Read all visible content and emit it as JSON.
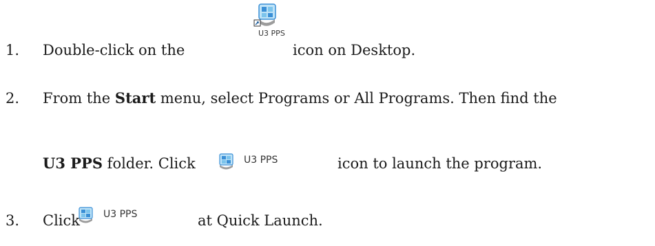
{
  "steps": [
    {
      "number": "1.",
      "text_before": "Double-click on the",
      "icon_label": "U3 PPS",
      "text_after": "icon on Desktop."
    },
    {
      "number": "2.",
      "line1_before": "From the",
      "line1_bold": "Start",
      "line1_after": "menu, select Programs or All Programs. Then find the",
      "line2_bold": "U3 PPS",
      "line2_mid": "folder. Click",
      "icon_label": "U3 PPS",
      "line2_after": "icon to launch the program."
    },
    {
      "number": "3.",
      "text_before": "Click",
      "icon_label": "U3 PPS",
      "text_after": "at Quick Launch."
    }
  ],
  "icons": {
    "desktop_shortcut": "u3-pps-shortcut-icon",
    "program": "u3-pps-program-icon"
  },
  "colors": {
    "icon_blue": "#3a8fd6",
    "icon_light": "#bfe3f7",
    "icon_dark": "#1f5e9c",
    "text": "#1a1a1a"
  }
}
